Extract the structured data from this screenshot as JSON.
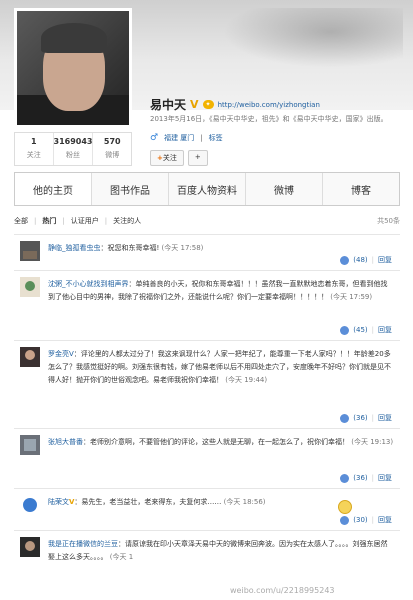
{
  "profile": {
    "name": "易中天",
    "url": "http://weibo.com/yizhongtian",
    "intro": "2013年5月16日，《易中天中华史，祖先》和《易中天中华史，国家》出版。",
    "location": "福建 厦门",
    "tag": "标签",
    "follow_label": "关注",
    "more_label": "+"
  },
  "stats": [
    {
      "value": "1",
      "label": "关注"
    },
    {
      "value": "3169043",
      "label": "粉丝"
    },
    {
      "value": "570",
      "label": "微博"
    }
  ],
  "tabs": [
    "他的主页",
    "图书作品",
    "百度人物资料",
    "微博",
    "博客"
  ],
  "filter": {
    "all": "全部",
    "hot": "热门",
    "verified": "认证用户",
    "following": "关注的人",
    "count": "共50条"
  },
  "reply_label": "回复",
  "comments": [
    {
      "user": "静临_独孤看虫虫",
      "text": "：祝您和东哥幸福!",
      "time": "(今天 17:58)",
      "likes": "(48)"
    },
    {
      "user": "沈粥_不小心就找到相声界",
      "text": "：单纯善良的小天，祝你和东哥幸福！！！虽然我一直默默地恋着东哥，但看到他找到了他心目中的男神，我除了祝福你们之外，还能说什么呢？你们一定要幸福啊！！！！！",
      "time": "(今天 17:59)",
      "likes": "(45)"
    },
    {
      "user": "罗金亮V",
      "text": "：评论里的人都太过分了！我这来讽现什么？人家一把年纪了，能尊重一下老人家吗？！！年龄差20多怎么了？我感觉挺好的啊。刘强东很有钱，嫁了他易老师以后不用四处走穴了，安度晚年不好吗？你们就是见不得人好！抛开你们的世俗观念吧。易老师我祝你们幸福！",
      "time": "(今天 19:44)",
      "likes": "(36)"
    },
    {
      "user": "张旭大普番",
      "text": "：老师别介意啊，不要管他们的评论，这些人就是无聊，在一起怎么了，祝你们幸福！",
      "time": "(今天 19:13)",
      "likes": "(36)"
    },
    {
      "user": "陆荣文",
      "text": "：易先生，老当益壮，老来得东，夫复何求……",
      "time": "(今天 18:56)",
      "likes": "(30)"
    },
    {
      "user": "我是正在播微信的兰豆",
      "text": "：请原谅我在印小天章泽天易中天的微博来回奔波。因为实在太感人了。。。。刘强东居然娶上这么多天。。。。",
      "time": "(今天 1",
      "likes": ""
    }
  ],
  "watermark": "weibo.com/u/2218995243"
}
